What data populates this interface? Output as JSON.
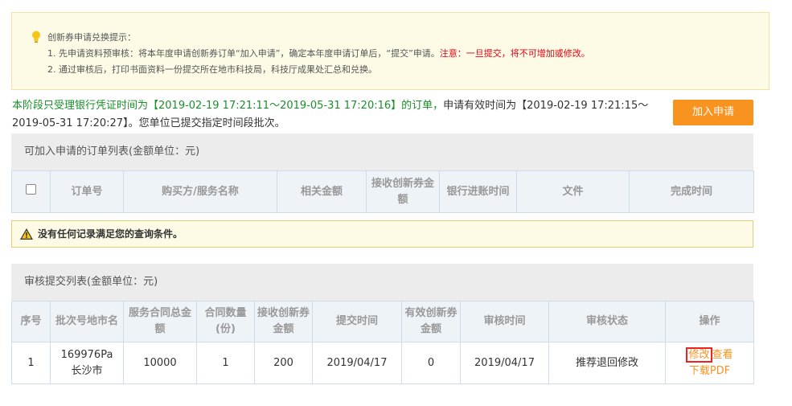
{
  "notice": {
    "title": "创新券申请兑换提示：",
    "line1_main": "1. 先申请资料预审核：将本年度申请创新券订单“加入申请”，确定本年度申请订单后，“提交”申请。",
    "line1_warn": "注意：一旦提交，将不可增加或修改。",
    "line2": "2. 通过审核后，打印书面资料一份提交所在地市科技局，科技厅成果处汇总和兑换。"
  },
  "period": {
    "green_text": "本阶段只受理银行凭证时间为【2019-02-19 17:21:11～2019-05-31 17:20:16】的订单，",
    "rest_text": "申请有效时间为【2019-02-19 17:21:15～2019-05-31 17:20:27】。您单位已提交指定时间段批次。"
  },
  "add_button": "加入申请",
  "order_section": {
    "title": "可加入申请的订单列表(金额单位：元)",
    "headers": [
      "订单号",
      "购买方/服务名称",
      "相关金额",
      "接收创新券金额",
      "银行进账时间",
      "文件",
      "完成时间"
    ]
  },
  "no_data_text": "没有任何记录满足您的查询条件。",
  "review_section": {
    "title": "审核提交列表(金额单位：元)",
    "headers": [
      "序号",
      "批次号地市名",
      "服务合同总金额",
      "合同数量(份)",
      "接收创新券金额",
      "提交时间",
      "有效创新券金额",
      "审核时间",
      "审核状态",
      "操作"
    ],
    "rows": [
      {
        "index": "1",
        "batch": "169976Pa",
        "city": "长沙市",
        "contract_total": "10000",
        "contract_count": "1",
        "voucher_amount": "200",
        "submit_time": "2019/04/17",
        "valid_amount": "0",
        "review_time": "2019/04/17",
        "status": "推荐退回修改",
        "op_edit": "修改",
        "op_view": "查看",
        "op_pdf": "下载PDF"
      }
    ]
  },
  "colors": {
    "accent": "#f7931e",
    "warn": "#e60012",
    "green": "#1a8f2a"
  }
}
